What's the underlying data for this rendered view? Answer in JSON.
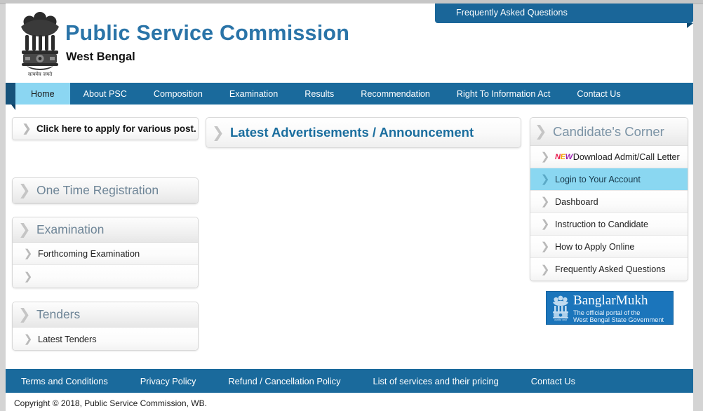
{
  "header": {
    "emblem_alt": "State Emblem of India",
    "title": "Public Service Commission",
    "subtitle": "West Bengal"
  },
  "faq_ribbon": {
    "label": "Frequently Asked Questions"
  },
  "nav": {
    "items": [
      {
        "label": "Home",
        "active": true
      },
      {
        "label": "About PSC",
        "active": false
      },
      {
        "label": "Composition",
        "active": false
      },
      {
        "label": "Examination",
        "active": false
      },
      {
        "label": "Results",
        "active": false
      },
      {
        "label": "Recommendation",
        "active": false
      },
      {
        "label": "Right To Information Act",
        "active": false
      },
      {
        "label": "Contact Us",
        "active": false
      }
    ]
  },
  "sidebar": {
    "apply_link": "Click here to apply for various post.",
    "one_time_registration": {
      "title": "One Time Registration"
    },
    "examination": {
      "title": "Examination",
      "rows": [
        {
          "label": "Forthcoming Examination"
        },
        {
          "label": ""
        }
      ]
    },
    "tenders": {
      "title": "Tenders",
      "rows": [
        {
          "label": "Latest Tenders"
        }
      ]
    }
  },
  "main": {
    "advertisements_title": "Latest Advertisements / Announcement"
  },
  "candidates_corner": {
    "title": "Candidate's Corner",
    "items": [
      {
        "label": "Download Admit/Call Letter",
        "badge": "NEW",
        "selected": false
      },
      {
        "label": "Login to Your Account",
        "badge": "",
        "selected": true
      },
      {
        "label": "Dashboard",
        "badge": "",
        "selected": false
      },
      {
        "label": "Instruction to Candidate",
        "badge": "",
        "selected": false
      },
      {
        "label": "How to Apply Online",
        "badge": "",
        "selected": false
      },
      {
        "label": "Frequently Asked Questions",
        "badge": "",
        "selected": false
      }
    ]
  },
  "banner": {
    "title": "BanglarMukh",
    "line1": "The official portal of  the",
    "line2": "West Bengal State Government"
  },
  "footer": {
    "links": [
      "Terms and Conditions",
      "Privacy Policy",
      "Refund / Cancellation Policy",
      "List of services and their pricing",
      "Contact Us"
    ],
    "copyright": "Copyright © 2018, Public Service Commission, WB."
  },
  "colors": {
    "brand_blue": "#1a6a9c",
    "brand_dark": "#0e4166",
    "title_blue": "#2a74a8",
    "highlight_cyan": "#8bd6f2",
    "banner_blue": "#1b75bb"
  }
}
